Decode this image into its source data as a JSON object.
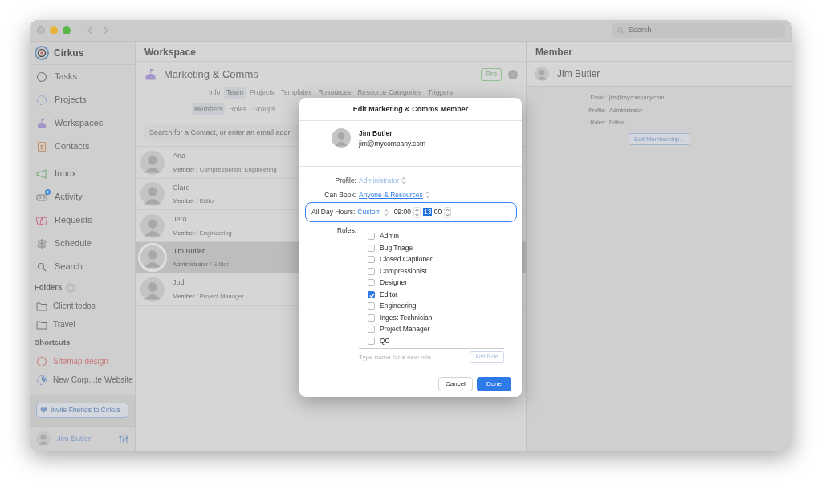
{
  "window": {
    "search_placeholder": "Search"
  },
  "sidebar": {
    "app_name": "Cirkus",
    "items": [
      {
        "label": "Tasks",
        "kind": "tasks",
        "notification": false
      },
      {
        "label": "Projects",
        "kind": "projects",
        "notification": false
      },
      {
        "label": "Workspaces",
        "kind": "workspaces",
        "notification": false
      },
      {
        "label": "Contacts",
        "kind": "contacts",
        "notification": false
      },
      {
        "label": "Inbox",
        "kind": "inbox",
        "notification": false
      },
      {
        "label": "Activity",
        "kind": "activity",
        "notification": true
      },
      {
        "label": "Requests",
        "kind": "requests",
        "notification": false
      },
      {
        "label": "Schedule",
        "kind": "schedule",
        "notification": false
      },
      {
        "label": "Search",
        "kind": "search",
        "notification": false
      }
    ],
    "folders_heading": "Folders",
    "folders": [
      {
        "label": "Client todos"
      },
      {
        "label": "Travel"
      }
    ],
    "shortcuts_heading": "Shortcuts",
    "shortcuts": [
      {
        "label": "Sitemap design",
        "kind": "task",
        "color": "#c97a7a"
      },
      {
        "label": "New Corp...te Website",
        "kind": "project",
        "color": "#6f8fc4"
      }
    ],
    "invite_button": "Invite Friends to Cirkus",
    "user": "Jim Butler"
  },
  "workspace": {
    "heading": "Workspace",
    "name": "Marketing & Comms",
    "badge": "Pro",
    "tabs": [
      {
        "label": "Info",
        "selected": false
      },
      {
        "label": "Team",
        "selected": true
      },
      {
        "label": "Projects",
        "selected": false
      },
      {
        "label": "Templates",
        "selected": false
      },
      {
        "label": "Resources",
        "selected": false
      },
      {
        "label": "Resource Categories",
        "selected": false
      },
      {
        "label": "Triggers",
        "selected": false
      }
    ],
    "subtabs": [
      {
        "label": "Members",
        "selected": true
      },
      {
        "label": "Roles",
        "selected": false
      },
      {
        "label": "Groups",
        "selected": false
      }
    ],
    "search": {
      "placeholder": "Search for a Contact, or enter an email addr"
    },
    "members": [
      {
        "name": "Ana",
        "profile": "Member",
        "roles": "/ Compressionist, Engineering",
        "selected": false
      },
      {
        "name": "Clare",
        "profile": "Member",
        "roles": "/ Editor",
        "selected": false
      },
      {
        "name": "Jero",
        "profile": "Member",
        "roles": "/ Engineering",
        "selected": false
      },
      {
        "name": "Jim Butler",
        "profile": "Administrator",
        "roles": "/ Editor",
        "selected": true
      },
      {
        "name": "Jodi",
        "profile": "Member",
        "roles": "/ Project Manager",
        "selected": false
      }
    ]
  },
  "member_panel": {
    "heading": "Member",
    "name": "Jim Butler",
    "fields": [
      {
        "label": "Email:",
        "value": "jim@mycompany.com"
      },
      {
        "label": "Profile:",
        "value": "Administrator"
      },
      {
        "label": "Roles:",
        "value": "Editor"
      }
    ],
    "button": "Edit Membership..."
  },
  "dialog": {
    "title": "Edit Marketing & Comms Member",
    "user": {
      "name": "Jim Butler",
      "email": "jim@mycompany.com"
    },
    "profile": {
      "label": "Profile:",
      "value": "Administrator",
      "disabled": true
    },
    "can_book": {
      "label": "Can Book:",
      "value": "Anyone & Resources",
      "disabled": false
    },
    "all_day_hours": {
      "label": "All Day Hours:",
      "mode": "Custom",
      "start": "09:00",
      "end_hour": "13",
      "end_rest": ":00",
      "focused": true
    },
    "roles_label": "Roles:",
    "roles": [
      {
        "label": "Admin",
        "checked": false
      },
      {
        "label": "Bug Triage",
        "checked": false
      },
      {
        "label": "Closed Captioner",
        "checked": false
      },
      {
        "label": "Compressionist",
        "checked": false
      },
      {
        "label": "Designer",
        "checked": false
      },
      {
        "label": "Editor",
        "checked": true
      },
      {
        "label": "Engineering",
        "checked": false
      },
      {
        "label": "Ingest Technician",
        "checked": false
      },
      {
        "label": "Project Manager",
        "checked": false
      },
      {
        "label": "QC",
        "checked": false
      }
    ],
    "new_role_placeholder": "Type name for a new role",
    "add_role_button": "Add Role",
    "cancel_button": "Cancel",
    "done_button": "Done"
  }
}
